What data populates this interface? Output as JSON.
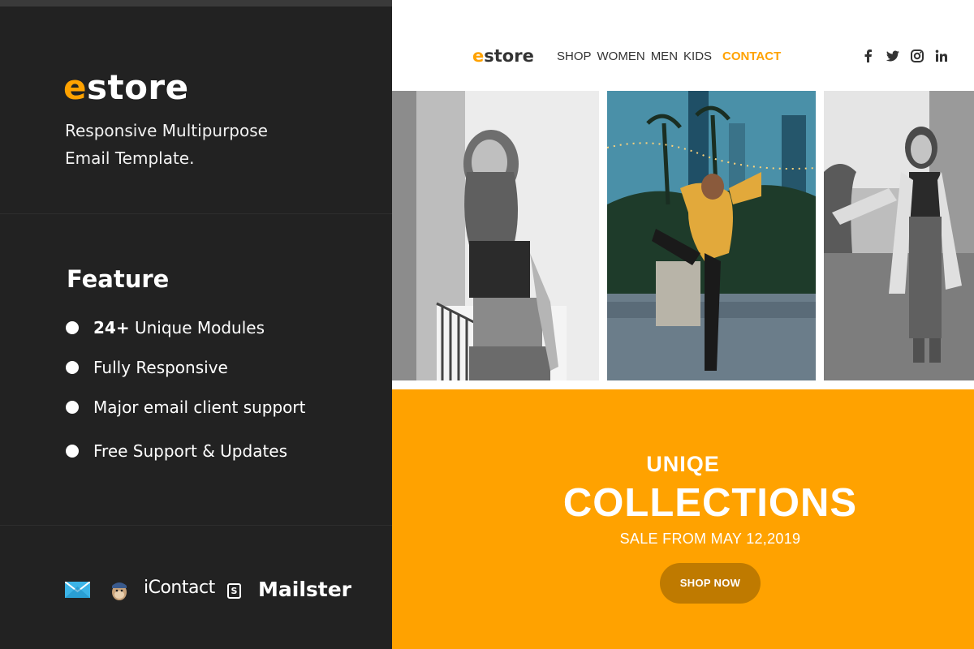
{
  "left_panel": {
    "brand": {
      "first_letter": "e",
      "rest": "store"
    },
    "tagline_line1": "Responsive Multipurpose",
    "tagline_line2": "Email Template.",
    "feature_title": "Feature",
    "features": [
      {
        "bold": "24+",
        "text": " Unique Modules"
      },
      {
        "bold": "",
        "text": "Fully Responsive"
      },
      {
        "bold": "",
        "text": "Major email client support"
      },
      {
        "bold": "",
        "text": "Free Support & Updates"
      }
    ],
    "support_logos": {
      "icons": [
        "campaign-monitor-mail-icon",
        "mailchimp-icon",
        "icontact-logo",
        "stampready-icon",
        "mailster-logo"
      ],
      "icontact_text": "iContact",
      "s_text": "S",
      "mailster_text": "Mailster"
    }
  },
  "email": {
    "brand": {
      "first_letter": "e",
      "rest": "store"
    },
    "nav": [
      "SHOP",
      "WOMEN",
      "MEN",
      "KIDS",
      "CONTACT"
    ],
    "nav_active": "CONTACT",
    "social_icons": [
      "facebook-icon",
      "twitter-icon",
      "instagram-icon",
      "linkedin-icon"
    ],
    "banner": {
      "subtitle": "UNIQE",
      "title": "COLLECTIONS",
      "date": "SALE FROM MAY 12,2019",
      "button": "SHOP NOW"
    }
  },
  "colors": {
    "accent": "#ffa200",
    "panel_bg": "#222222",
    "button_bg": "#bf7a00"
  }
}
